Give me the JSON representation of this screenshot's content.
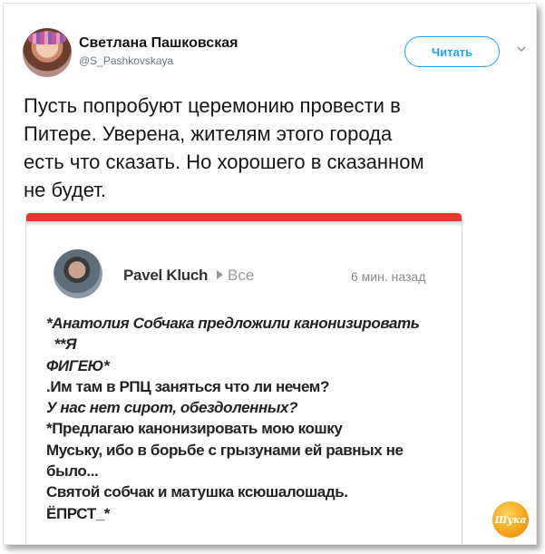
{
  "tweet": {
    "author_name": "Светлана Пашковская",
    "author_handle": "@S_Pashkovskaya",
    "follow_label": "Читать",
    "text": "Пусть попробуют церемонию провести в\nПитере. Уверена, жителям этого города\nесть что сказать. Но хорошего в сказанном\nне будет."
  },
  "embedded_post": {
    "author_name": "Pavel Kluch",
    "audience": "Все",
    "time": "6 мин. назад",
    "accent_color": "#e6382c",
    "lines": [
      "*Анатолия Собчака предложили канонизировать",
      "  **Я",
      "ФИГЕЮ*",
      ".Им там в РПЦ заняться что ли нечем?",
      "У нас нет сирот, обездоленных?",
      "*Предлагаю канонизировать мою кошку",
      "Муську, ибо в борьбе с грызунами ей равных не",
      "было...",
      "Святой собчак и матушка ксюшалошадь.",
      "ЁПРСТ_*"
    ]
  },
  "watermark": {
    "text": "Шука"
  },
  "icons": {
    "menu": "chevron-down-icon"
  },
  "colors": {
    "twitter_blue": "#1da1f2",
    "text": "#14171a",
    "secondary": "#657786"
  }
}
